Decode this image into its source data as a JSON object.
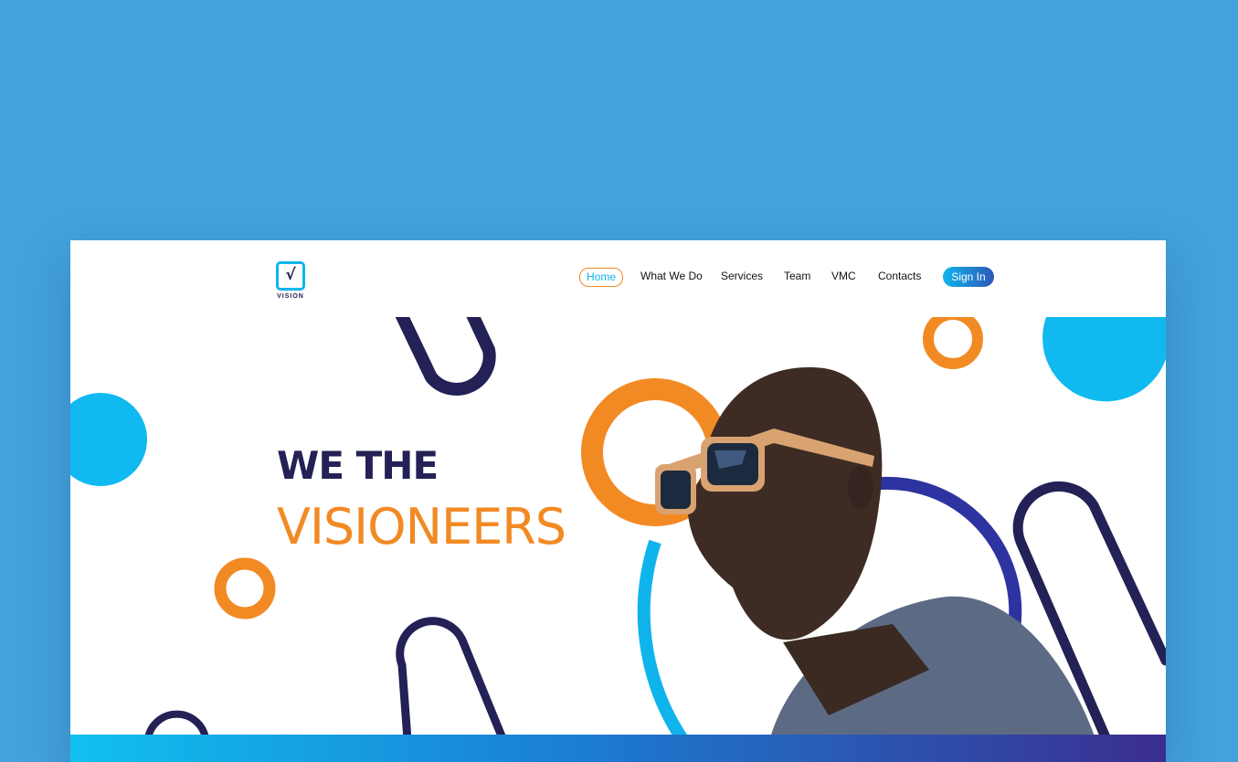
{
  "brand": {
    "name": "VISION",
    "mark": "√"
  },
  "nav": {
    "home": "Home",
    "items": [
      "What We Do",
      "Services",
      "Team",
      "VMC",
      "Contacts"
    ],
    "signin": "Sign In"
  },
  "hero": {
    "line1": "WE THE",
    "line2": "VISIONEERS"
  },
  "colors": {
    "background": "#43a1dc",
    "navy": "#232155",
    "orange": "#f28a24",
    "cyan": "#10b4ec"
  }
}
